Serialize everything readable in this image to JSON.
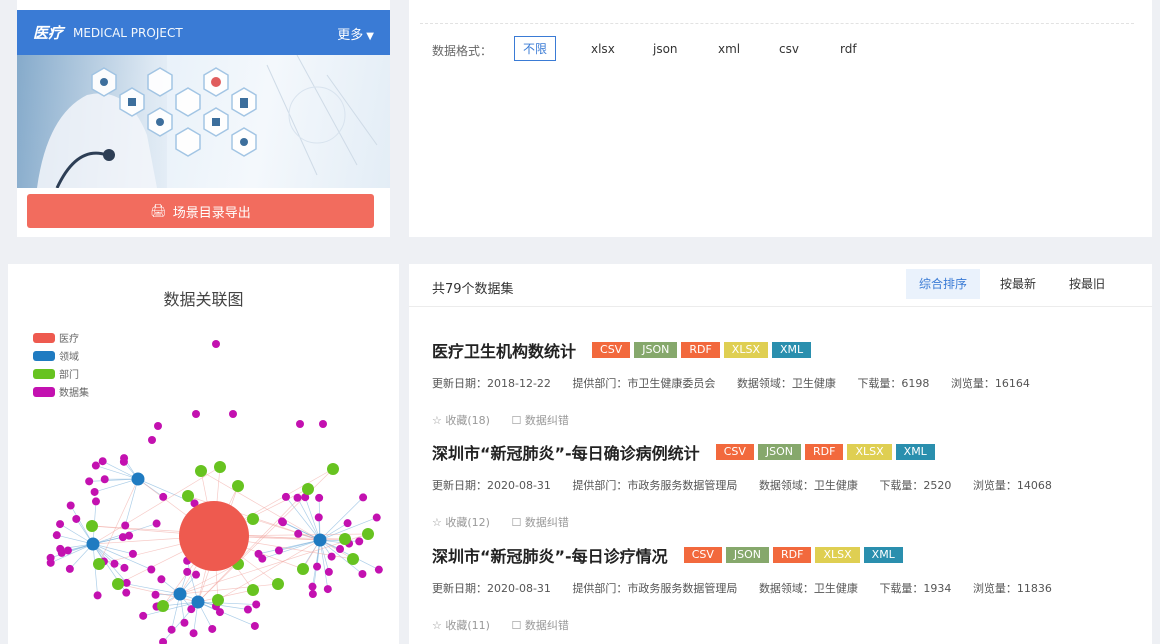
{
  "scene": {
    "title": "医疗",
    "subtitle": "MEDICAL PROJECT",
    "more_label": "更多",
    "export_label": "场景目录导出"
  },
  "filter": {
    "label": "数据格式：",
    "options": [
      "不限",
      "xlsx",
      "json",
      "xml",
      "csv",
      "rdf"
    ],
    "selected": "不限"
  },
  "graph": {
    "title": "数据关联图",
    "legend": [
      {
        "label": "医疗",
        "color": "#ee5a4f"
      },
      {
        "label": "领域",
        "color": "#1f7bc1"
      },
      {
        "label": "部门",
        "color": "#67c320"
      },
      {
        "label": "数据集",
        "color": "#c311b0"
      }
    ]
  },
  "list": {
    "count_text": "共79个数据集",
    "sort_options": [
      "综合排序",
      "按最新",
      "按最旧"
    ],
    "active_sort": "综合排序",
    "tag_colors": {
      "CSV": "#f2693d",
      "JSON": "#86a86c",
      "RDF": "#f2693d",
      "XLSX": "#dfcf52",
      "XML": "#2a8fae"
    },
    "datasets": [
      {
        "title": "医疗卫生机构数统计",
        "tags": [
          "CSV",
          "JSON",
          "RDF",
          "XLSX",
          "XML"
        ],
        "update": "更新日期：2018-12-22",
        "dept": "提供部门：市卫生健康委员会",
        "domain": "数据领域：卫生健康",
        "downloads": "下载量：6198",
        "views": "浏览量：16164",
        "favorite": "☆ 收藏(18)",
        "report": "数据纠错"
      },
      {
        "title": "深圳市“新冠肺炎”-每日确诊病例统计",
        "tags": [
          "CSV",
          "JSON",
          "RDF",
          "XLSX",
          "XML"
        ],
        "update": "更新日期：2020-08-31",
        "dept": "提供部门：市政务服务数据管理局",
        "domain": "数据领域：卫生健康",
        "downloads": "下载量：2520",
        "views": "浏览量：14068",
        "favorite": "☆ 收藏(12)",
        "report": "数据纠错"
      },
      {
        "title": "深圳市“新冠肺炎”-每日诊疗情况",
        "tags": [
          "CSV",
          "JSON",
          "RDF",
          "XLSX",
          "XML"
        ],
        "update": "更新日期：2020-08-31",
        "dept": "提供部门：市政务服务数据管理局",
        "domain": "数据领域：卫生健康",
        "downloads": "下载量：1934",
        "views": "浏览量：11836",
        "favorite": "☆ 收藏(11)",
        "report": "数据纠错"
      }
    ]
  }
}
